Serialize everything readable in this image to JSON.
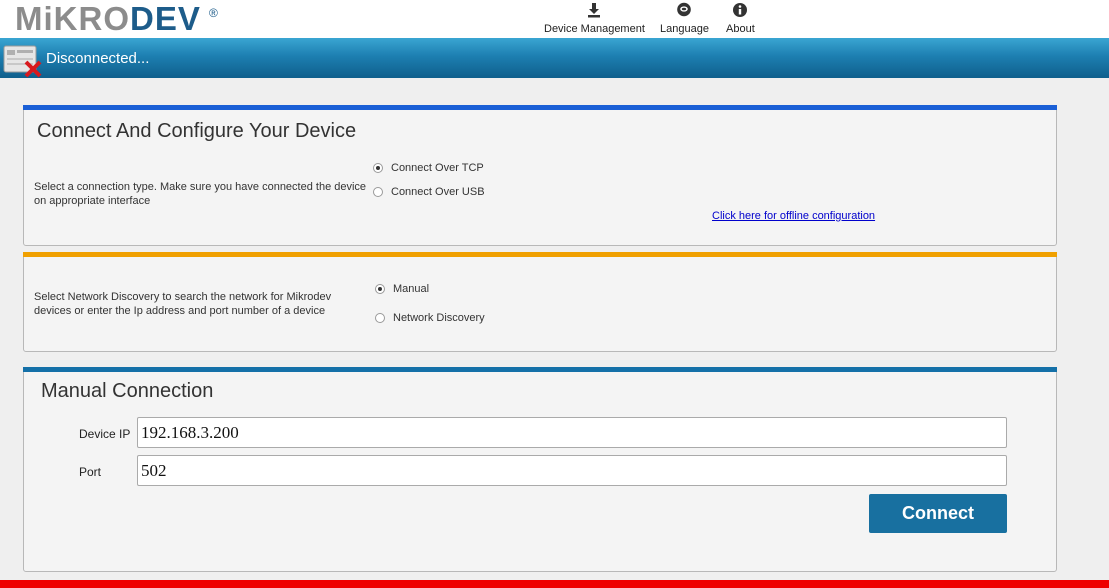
{
  "brand": {
    "logo_part1": "MiKRO",
    "logo_part2": "DEV",
    "registered": "®"
  },
  "nav": {
    "device_management": "Device Management",
    "language": "Language",
    "about": "About"
  },
  "status": {
    "text": "Disconnected..."
  },
  "connect_panel": {
    "title": "Connect And Configure Your Device",
    "description": "Select a connection type. Make sure you have connected the device on appropriate interface",
    "options": [
      {
        "label": "Connect Over TCP",
        "checked": true
      },
      {
        "label": "Connect Over USB",
        "checked": false
      }
    ],
    "offline_link": "Click here for offline configuration",
    "accent": "#1a5fd6"
  },
  "discovery_panel": {
    "description": "Select Network Discovery to search the network for Mikrodev devices or enter the Ip address and port number of a device",
    "options": [
      {
        "label": "Manual",
        "checked": true
      },
      {
        "label": "Network Discovery",
        "checked": false
      }
    ],
    "accent": "#f0a000"
  },
  "manual_panel": {
    "title": "Manual Connection",
    "ip_label": "Device IP",
    "ip_value": "192.168.3.200",
    "port_label": "Port",
    "port_value": "502",
    "connect_label": "Connect",
    "accent": "#1470a8"
  },
  "colors": {
    "status_bar": "#1d7fb1",
    "button": "#1870a0",
    "footer": "#ee0000"
  }
}
